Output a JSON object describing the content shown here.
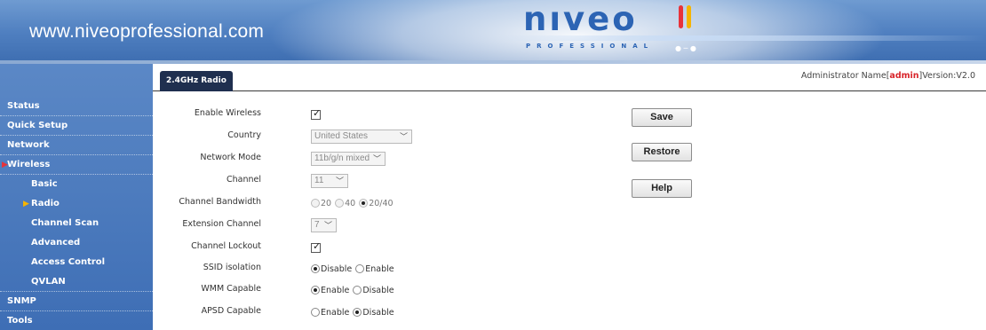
{
  "header": {
    "site_url": "www.niveoprofessional.com",
    "logo_text": "nıveo",
    "logo_subtext": "PROFESSIONAL",
    "colors": {
      "brand_blue": "#2c64b4",
      "bar_red": "#e8333a",
      "bar_yellow": "#f5b400"
    }
  },
  "topbar": {
    "tab_label": "2.4GHz Radio",
    "admin_prefix": "Administrator Name[",
    "admin_name": "admin",
    "admin_suffix": "]Version:V2.0"
  },
  "sidebar": {
    "items": [
      {
        "label": "Status"
      },
      {
        "label": "Quick Setup"
      },
      {
        "label": "Network"
      },
      {
        "label": "Wireless",
        "expanded": true
      },
      {
        "label": "Basic"
      },
      {
        "label": "Radio",
        "active": true
      },
      {
        "label": "Channel Scan"
      },
      {
        "label": "Advanced"
      },
      {
        "label": "Access Control"
      },
      {
        "label": "QVLAN"
      },
      {
        "label": "SNMP"
      },
      {
        "label": "Tools"
      }
    ],
    "colors": {
      "expand_arrow": "#e8333a",
      "active_arrow": "#f5b400"
    }
  },
  "form": {
    "enable_wireless": {
      "label": "Enable Wireless",
      "checked": true
    },
    "country": {
      "label": "Country",
      "value": "United States"
    },
    "network_mode": {
      "label": "Network Mode",
      "value": "11b/g/n mixed"
    },
    "channel": {
      "label": "Channel",
      "value": "11"
    },
    "channel_bandwidth": {
      "label": "Channel Bandwidth",
      "options": [
        "20",
        "40",
        "20/40"
      ],
      "selected": "20/40"
    },
    "extension_channel": {
      "label": "Extension Channel",
      "value": "7"
    },
    "channel_lockout": {
      "label": "Channel Lockout",
      "checked": true
    },
    "ssid_isolation": {
      "label": "SSID isolation",
      "options": [
        "Disable",
        "Enable"
      ],
      "selected": "Disable"
    },
    "wmm_capable": {
      "label": "WMM Capable",
      "options": [
        "Enable",
        "Disable"
      ],
      "selected": "Enable"
    },
    "apsd_capable": {
      "label": "APSD Capable",
      "options": [
        "Enable",
        "Disable"
      ],
      "selected": "Disable"
    }
  },
  "buttons": {
    "save": "Save",
    "restore": "Restore",
    "help": "Help"
  }
}
